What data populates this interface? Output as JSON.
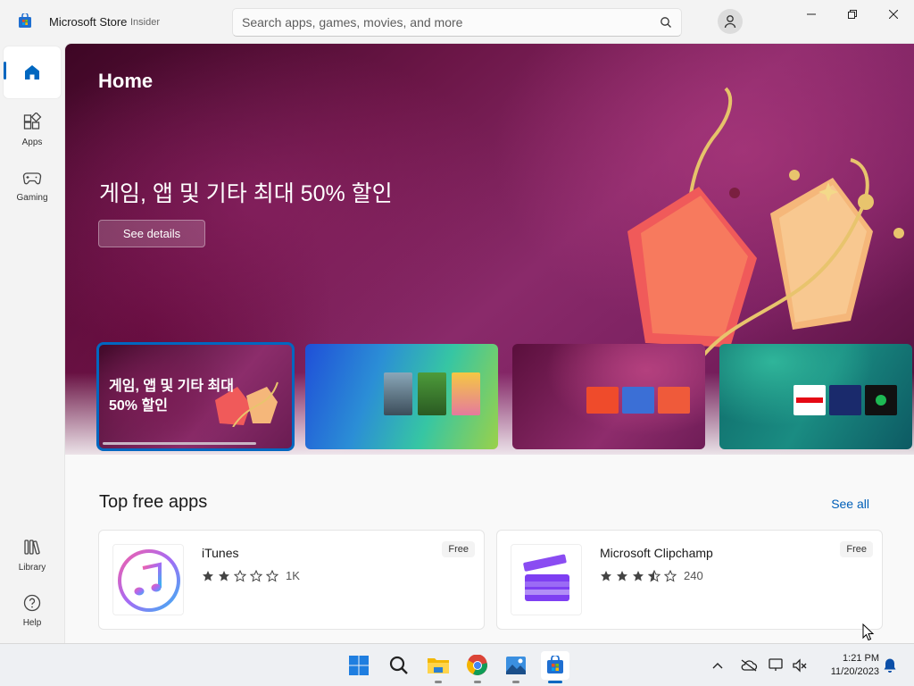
{
  "titlebar": {
    "app_title": "Microsoft Store",
    "badge": "Insider",
    "search_placeholder": "Search apps, games, movies, and more"
  },
  "sidebar": {
    "items": [
      {
        "id": "home",
        "label": "",
        "icon": "home-icon",
        "selected": true
      },
      {
        "id": "apps",
        "label": "Apps",
        "icon": "apps-icon"
      },
      {
        "id": "gaming",
        "label": "Gaming",
        "icon": "gamepad-icon"
      },
      {
        "id": "library",
        "label": "Library",
        "icon": "library-icon"
      },
      {
        "id": "help",
        "label": "Help",
        "icon": "help-icon"
      }
    ]
  },
  "hero": {
    "title": "Home",
    "headline": "게임, 앱 및 기타 최대 50% 할인",
    "button": "See details"
  },
  "carousel": {
    "cards": [
      {
        "caption": "게임, 앱 및 기타 최대 50% 할인",
        "selected": true
      },
      {
        "caption": ""
      },
      {
        "caption": "",
        "logos": [
          "Rakuten",
          "Dolby",
          "dts"
        ]
      },
      {
        "caption": "",
        "logos": [
          "NETFLIX",
          "Disney+",
          "Spotify"
        ]
      }
    ]
  },
  "top_free_apps": {
    "title": "Top free apps",
    "see_all": "See all",
    "apps": [
      {
        "name": "iTunes",
        "rating": 2,
        "rating_count": "1K",
        "price": "Free"
      },
      {
        "name": "Microsoft Clipchamp",
        "rating": 3.5,
        "rating_count": "240",
        "price": "Free"
      }
    ]
  },
  "taskbar": {
    "time": "1:21 PM",
    "date": "11/20/2023"
  },
  "colors": {
    "accent": "#0067c0",
    "link": "#005fb8"
  }
}
